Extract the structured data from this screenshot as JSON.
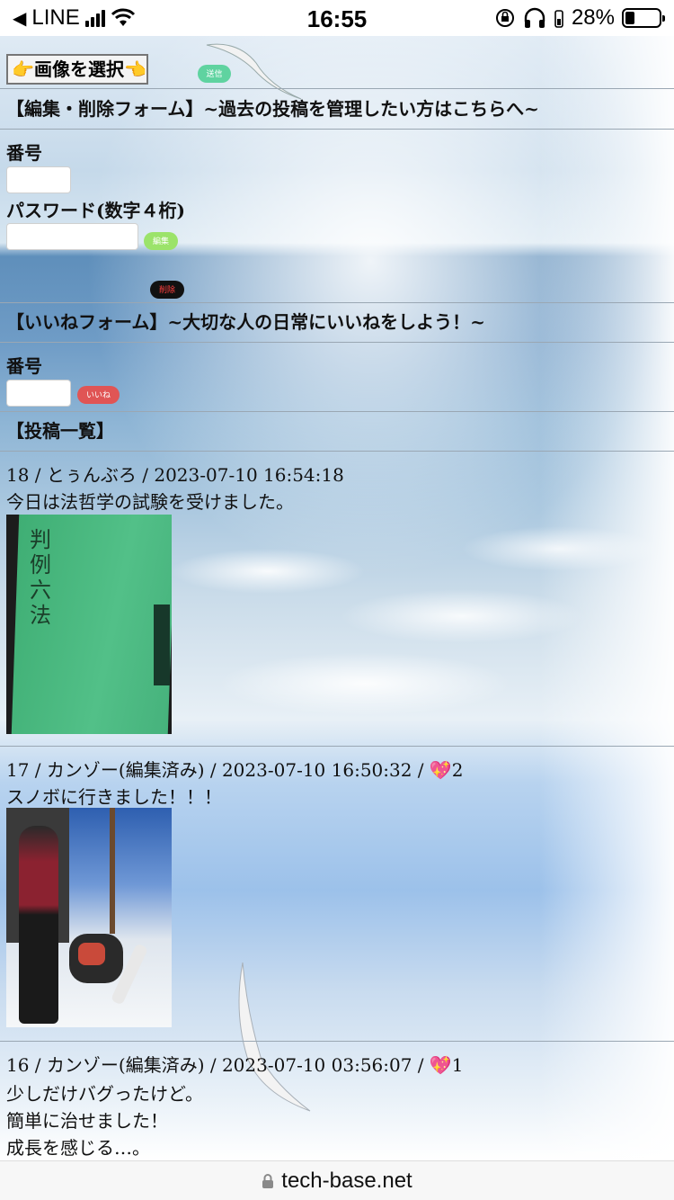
{
  "status_bar": {
    "carrier": "LINE",
    "time": "16:55",
    "battery": "28%",
    "battery_level": 0.28
  },
  "upload": {
    "file_button_label": "👉画像を選択👈",
    "send_label": "送信"
  },
  "edit_form": {
    "heading": "【編集・削除フォーム】~過去の投稿を管理したい方はこちらへ~",
    "number_label": "番号",
    "password_label": "パスワード(数字４桁)",
    "edit_label": "編集",
    "delete_label": "削除"
  },
  "like_form": {
    "heading": "【いいねフォーム】~大切な人の日常にいいねをしよう！~",
    "number_label": "番号",
    "like_label": "いいね"
  },
  "posts_heading": "【投稿一覧】",
  "posts": [
    {
      "header": "18 / とぅんぶろ / 2023-07-10 16:54:18",
      "lines": [
        "今日は法哲学の試験を受けました。"
      ],
      "image_icon": "green-law-book-photo",
      "book_title": "判例六法"
    },
    {
      "header": "17 / カンゾー(編集済み) / 2023-07-10 16:50:32 / 💖2",
      "lines": [
        "スノボに行きました！！！"
      ],
      "image_icon": "snowboard-photo"
    },
    {
      "header": "16 / カンゾー(編集済み) / 2023-07-10 03:56:07 / 💖1",
      "lines": [
        "少しだけバグったけど。",
        "簡単に治せました！",
        "成長を感じる…。"
      ]
    }
  ],
  "url_bar": {
    "domain": "tech-base.net",
    "icon": "lock-icon"
  },
  "colors": {
    "send": "#5fd3a0",
    "edit": "#9be36a",
    "delete": "#111111",
    "delete_text": "#ff4040",
    "like": "#e05555"
  }
}
